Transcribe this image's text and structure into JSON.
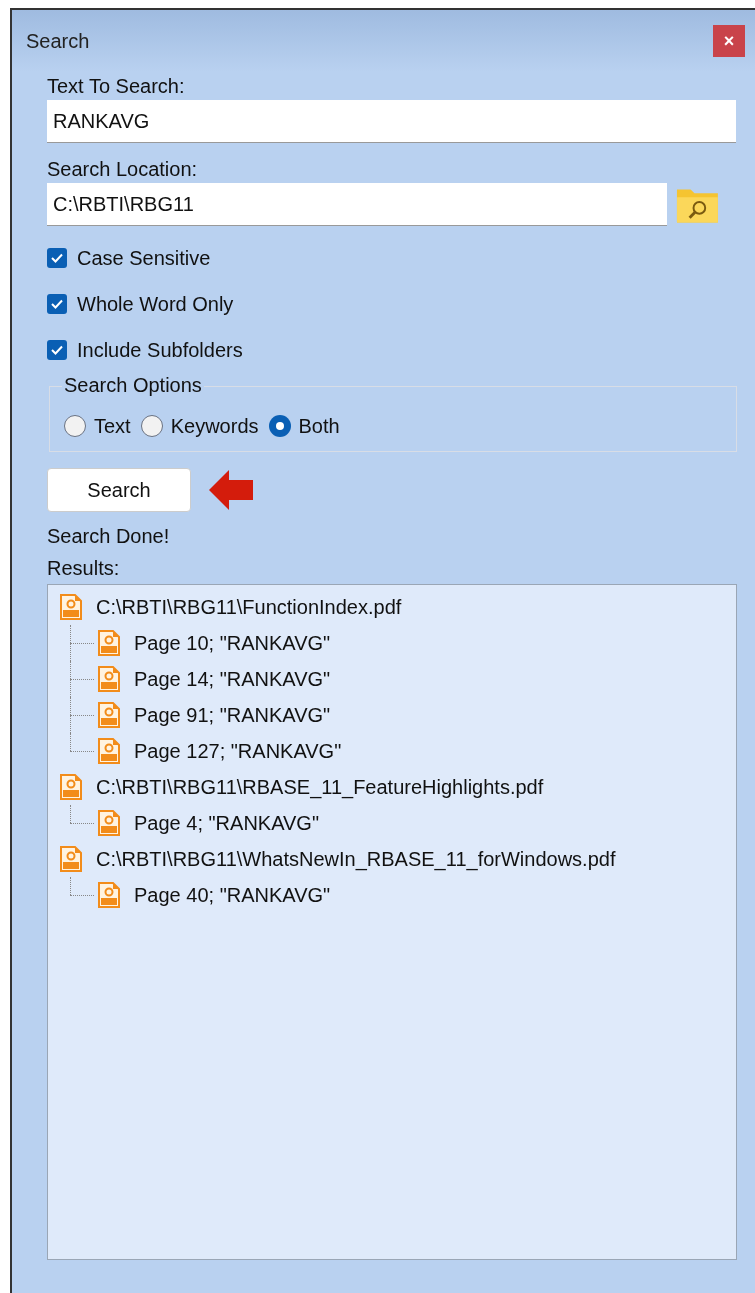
{
  "window": {
    "title": "Search",
    "close": "×"
  },
  "text_to_search": {
    "label": "Text To Search:",
    "value": "RANKAVG"
  },
  "search_location": {
    "label": "Search Location:",
    "value": "C:\\RBTI\\RBG11"
  },
  "checkboxes": [
    {
      "label": "Case Sensitive",
      "checked": true
    },
    {
      "label": "Whole Word Only",
      "checked": true
    },
    {
      "label": "Include Subfolders",
      "checked": true
    }
  ],
  "search_options": {
    "title": "Search Options",
    "options": [
      {
        "label": "Text",
        "selected": false
      },
      {
        "label": "Keywords",
        "selected": false
      },
      {
        "label": "Both",
        "selected": true
      }
    ]
  },
  "search_button": "Search",
  "status": "Search Done!",
  "results": {
    "label": "Results:",
    "items": [
      {
        "label": "C:\\RBTI\\RBG11\\FunctionIndex.pdf",
        "children": [
          {
            "label": "Page 10; \"RANKAVG\""
          },
          {
            "label": "Page 14; \"RANKAVG\""
          },
          {
            "label": "Page 91; \"RANKAVG\""
          },
          {
            "label": "Page 127; \"RANKAVG\""
          }
        ]
      },
      {
        "label": "C:\\RBTI\\RBG11\\RBASE_11_FeatureHighlights.pdf",
        "children": [
          {
            "label": "Page 4; \"RANKAVG\""
          }
        ]
      },
      {
        "label": "C:\\RBTI\\RBG11\\WhatsNewIn_RBASE_11_forWindows.pdf",
        "children": [
          {
            "label": "Page 40; \"RANKAVG\""
          }
        ]
      }
    ]
  }
}
